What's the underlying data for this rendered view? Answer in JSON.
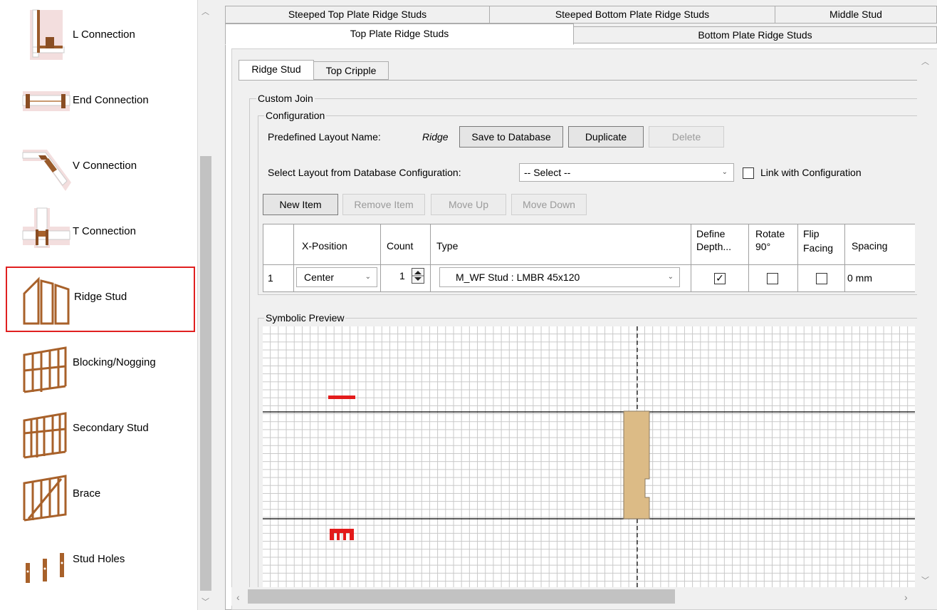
{
  "sidebar": {
    "items": [
      {
        "label": "L Connection",
        "icon": "l-connection-icon"
      },
      {
        "label": "End Connection",
        "icon": "end-connection-icon"
      },
      {
        "label": "V Connection",
        "icon": "v-connection-icon"
      },
      {
        "label": "T Connection",
        "icon": "t-connection-icon"
      },
      {
        "label": "Ridge Stud",
        "icon": "ridge-stud-icon",
        "selected": true
      },
      {
        "label": "Blocking/Nogging",
        "icon": "blocking-nogging-icon"
      },
      {
        "label": "Secondary Stud",
        "icon": "secondary-stud-icon"
      },
      {
        "label": "Brace",
        "icon": "brace-icon"
      },
      {
        "label": "Stud Holes",
        "icon": "stud-holes-icon"
      }
    ]
  },
  "tabs": {
    "row1": [
      "Steeped Top Plate Ridge Studs",
      "Steeped Bottom Plate Ridge Studs",
      "Middle Stud"
    ],
    "row2": [
      "Top Plate Ridge Studs",
      "Bottom Plate Ridge Studs"
    ],
    "active": "Top Plate Ridge Studs"
  },
  "subtabs": {
    "items": [
      "Ridge Stud",
      "Top Cripple"
    ],
    "active": "Ridge Stud"
  },
  "custom_join": {
    "title": "Custom Join",
    "configuration": {
      "title": "Configuration",
      "layout_name_label": "Predefined Layout Name:",
      "layout_name_value": "Ridge",
      "save_label": "Save to Database",
      "duplicate_label": "Duplicate",
      "delete_label": "Delete",
      "select_layout_label": "Select Layout from Database Configuration:",
      "select_value": "-- Select --",
      "link_label": "Link with Configuration",
      "link_checked": false
    },
    "toolbar": {
      "new_item": "New Item",
      "remove_item": "Remove Item",
      "move_up": "Move Up",
      "move_down": "Move Down"
    },
    "table": {
      "headers": {
        "x_position": "X-Position",
        "count": "Count",
        "type": "Type",
        "define_depth": [
          "Define",
          "Depth..."
        ],
        "rotate": [
          "Rotate",
          "90°"
        ],
        "flip": [
          "Flip",
          "Facing"
        ],
        "spacing": "Spacing"
      },
      "rows": [
        {
          "index": "1",
          "x_position": "Center",
          "count": "1",
          "type": "M_WF Stud : LMBR 45x120",
          "define_depth": true,
          "rotate": false,
          "flip": false,
          "spacing": "0 mm"
        }
      ]
    }
  },
  "preview": {
    "title": "Symbolic Preview"
  },
  "colors": {
    "selection_border": "#e02020",
    "stud_fill": "#dcbb86",
    "marker_red": "#e31b1b",
    "wood": "#a8612a"
  }
}
